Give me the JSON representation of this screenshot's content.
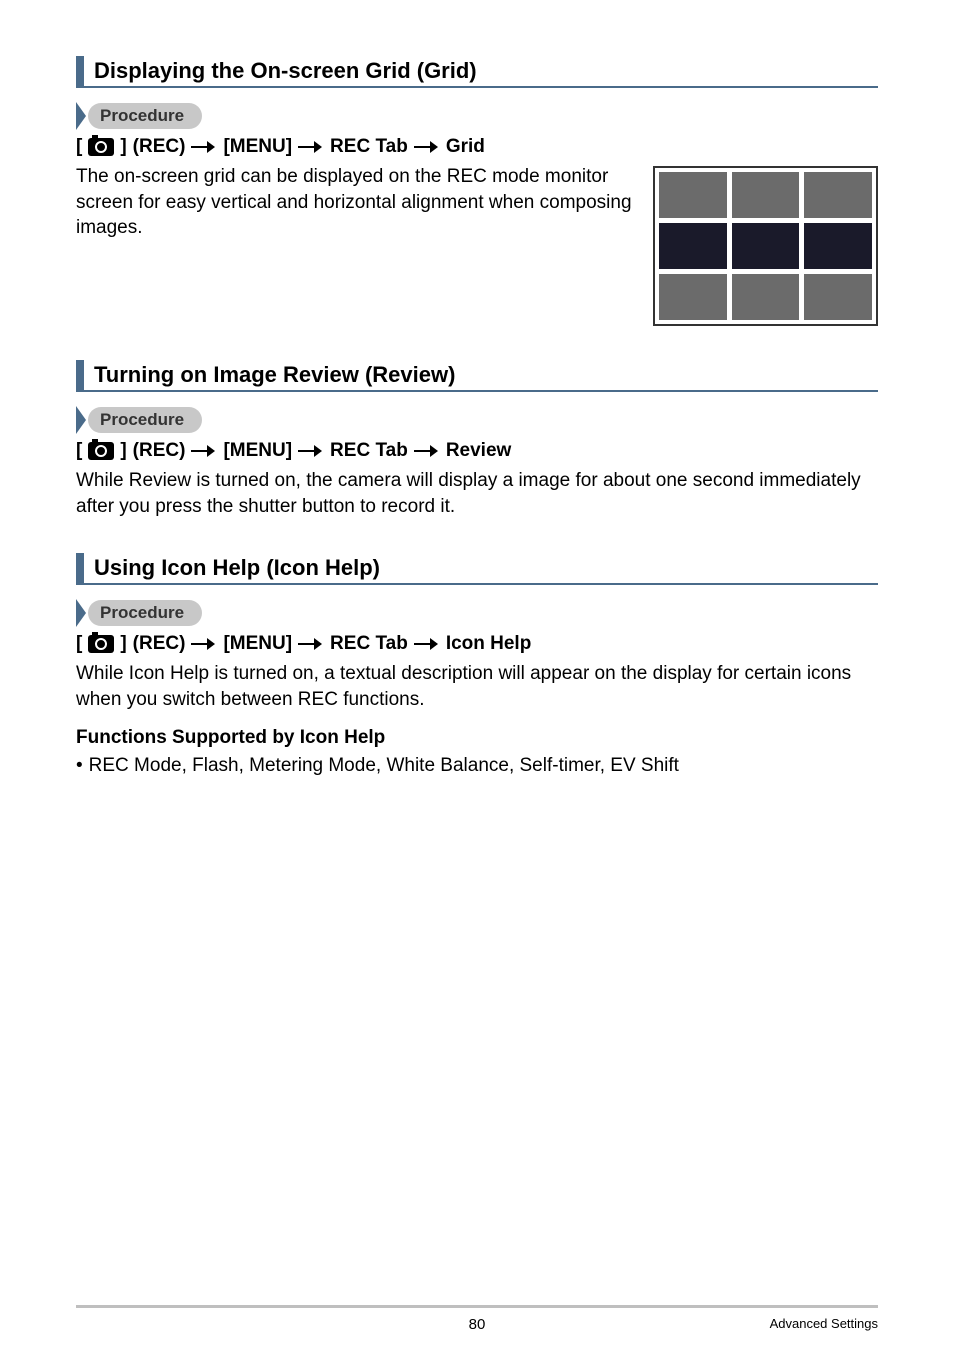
{
  "sections": {
    "grid": {
      "heading": "Displaying the On-screen Grid (Grid)",
      "procedure_label": "Procedure",
      "breadcrumb": {
        "rec": "(REC)",
        "menu": "[MENU]",
        "tab": "REC Tab",
        "item": "Grid"
      },
      "body": "The on-screen grid can be displayed on the REC mode monitor screen for easy vertical and horizontal alignment when composing images."
    },
    "review": {
      "heading": "Turning on Image Review (Review)",
      "procedure_label": "Procedure",
      "breadcrumb": {
        "rec": "(REC)",
        "menu": "[MENU]",
        "tab": "REC Tab",
        "item": "Review"
      },
      "body": "While Review is turned on, the camera will display a image for about one second immediately after you press the shutter button to record it."
    },
    "iconhelp": {
      "heading": "Using Icon Help (Icon Help)",
      "procedure_label": "Procedure",
      "breadcrumb": {
        "rec": "(REC)",
        "menu": "[MENU]",
        "tab": "REC Tab",
        "item": "Icon Help"
      },
      "body": "While Icon Help is turned on, a textual description will appear on the display for certain icons when you switch between REC functions.",
      "subhead": "Functions Supported by Icon Help",
      "bullet": "REC Mode, Flash, Metering Mode, White Balance, Self-timer, EV Shift"
    }
  },
  "footer": {
    "page": "80",
    "section": "Advanced Settings"
  }
}
